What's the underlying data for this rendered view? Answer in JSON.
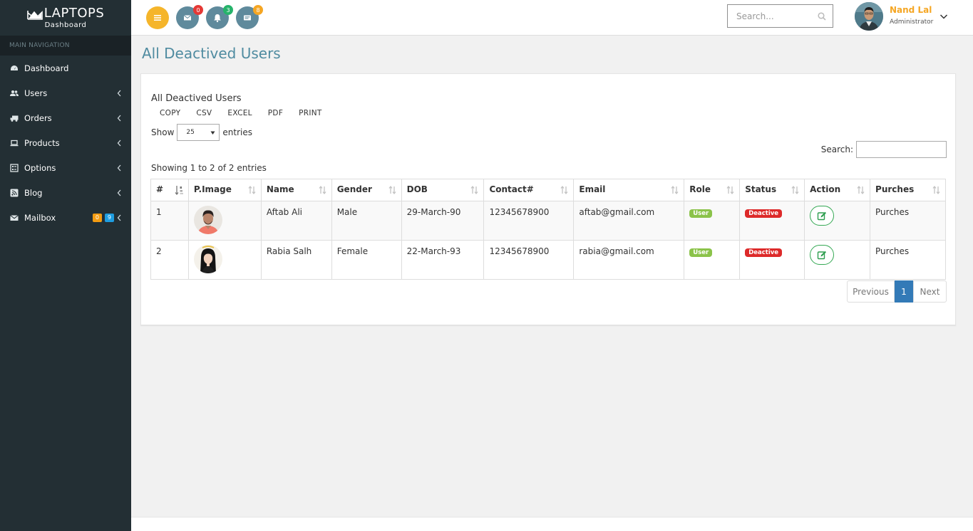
{
  "brand": {
    "name": "LAPTOPS",
    "subtitle": "Dashboard"
  },
  "sidebar": {
    "header": "MAIN NAVIGATION",
    "items": [
      {
        "label": "Dashboard",
        "icon": "dashboard-icon"
      },
      {
        "label": "Users",
        "icon": "users-icon"
      },
      {
        "label": "Orders",
        "icon": "truck-icon"
      },
      {
        "label": "Products",
        "icon": "laptop-icon"
      },
      {
        "label": "Options",
        "icon": "options-icon"
      },
      {
        "label": "Blog",
        "icon": "rss-icon"
      },
      {
        "label": "Mailbox",
        "icon": "envelope-icon",
        "badges": [
          "0",
          "9"
        ]
      }
    ]
  },
  "topbar": {
    "messages_count": "0",
    "notifications_count": "3",
    "tasks_count": "8",
    "search_placeholder": "Search...",
    "user_name": "Nand Lal",
    "user_role": "Administrator"
  },
  "page": {
    "title": "All Deactived Users",
    "box_title": "All Deactived Users",
    "export_buttons": [
      "COPY",
      "CSV",
      "EXCEL",
      "PDF",
      "PRINT"
    ],
    "show_label": "Show",
    "entries_value": "25",
    "entries_label": "entries",
    "search_label": "Search:",
    "info": "Showing 1 to 2 of 2 entries"
  },
  "table": {
    "columns": [
      "#",
      "P.Image",
      "Name",
      "Gender",
      "DOB",
      "Contact#",
      "Email",
      "Role",
      "Status",
      "Action",
      "Purches"
    ],
    "rows": [
      {
        "num": "1",
        "name": "Aftab Ali",
        "gender": "Male",
        "dob": "29-March-90",
        "contact": "12345678900",
        "email": "aftab@gmail.com",
        "role": "User",
        "status": "Deactive",
        "purches": "Purches"
      },
      {
        "num": "2",
        "name": "Rabia Salh",
        "gender": "Female",
        "dob": "22-March-93",
        "contact": "12345678900",
        "email": "rabia@gmail.com",
        "role": "User",
        "status": "Deactive",
        "purches": "Purches"
      }
    ]
  },
  "pagination": {
    "previous": "Previous",
    "current": "1",
    "next": "Next"
  },
  "colors": {
    "sidebar_bg": "#232f34",
    "title_color": "#4f8ba0",
    "accent_orange": "#f5a623",
    "pager_active": "#337ab7",
    "label_user": "#8bc34a",
    "label_deactive": "#dd2a2a"
  }
}
